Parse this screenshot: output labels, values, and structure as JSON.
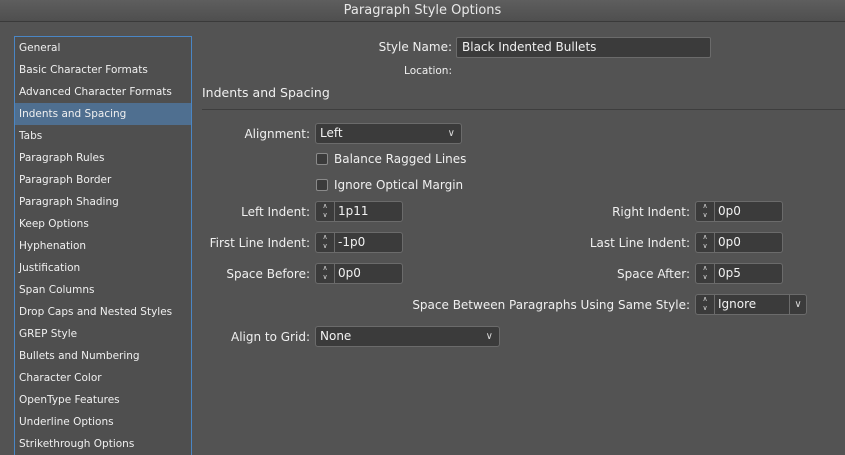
{
  "window": {
    "title": "Paragraph Style Options"
  },
  "sidebar": {
    "selected_index": 3,
    "items": [
      {
        "label": "General"
      },
      {
        "label": "Basic Character Formats"
      },
      {
        "label": "Advanced Character Formats"
      },
      {
        "label": "Indents and Spacing"
      },
      {
        "label": "Tabs"
      },
      {
        "label": "Paragraph Rules"
      },
      {
        "label": "Paragraph Border"
      },
      {
        "label": "Paragraph Shading"
      },
      {
        "label": "Keep Options"
      },
      {
        "label": "Hyphenation"
      },
      {
        "label": "Justification"
      },
      {
        "label": "Span Columns"
      },
      {
        "label": "Drop Caps and Nested Styles"
      },
      {
        "label": "GREP Style"
      },
      {
        "label": "Bullets and Numbering"
      },
      {
        "label": "Character Color"
      },
      {
        "label": "OpenType Features"
      },
      {
        "label": "Underline Options"
      },
      {
        "label": "Strikethrough Options"
      }
    ]
  },
  "header": {
    "style_name_label": "Style Name:",
    "style_name_value": "Black Indented Bullets",
    "location_label": "Location:"
  },
  "section": {
    "title": "Indents and Spacing"
  },
  "form": {
    "alignment": {
      "label": "Alignment:",
      "value": "Left"
    },
    "balance_ragged_lines": {
      "label": "Balance Ragged Lines",
      "checked": false
    },
    "ignore_optical_margin": {
      "label": "Ignore Optical Margin",
      "checked": false
    },
    "left_indent": {
      "label": "Left Indent:",
      "value": "1p11"
    },
    "first_line_indent": {
      "label": "First Line Indent:",
      "value": "-1p0"
    },
    "space_before": {
      "label": "Space Before:",
      "value": "0p0"
    },
    "right_indent": {
      "label": "Right Indent:",
      "value": "0p0"
    },
    "last_line_indent": {
      "label": "Last Line Indent:",
      "value": "0p0"
    },
    "space_after": {
      "label": "Space After:",
      "value": "0p5"
    },
    "space_between": {
      "label": "Space Between Paragraphs Using Same Style:",
      "value": "Ignore"
    },
    "align_to_grid": {
      "label": "Align to Grid:",
      "value": "None"
    }
  },
  "icons": {
    "chevron": "chevron-down-icon",
    "stepper": "stepper-arrows-icon"
  },
  "colors": {
    "background": "#535353",
    "selection": "#4f6f90",
    "sidebar_border": "#4a86c5"
  }
}
